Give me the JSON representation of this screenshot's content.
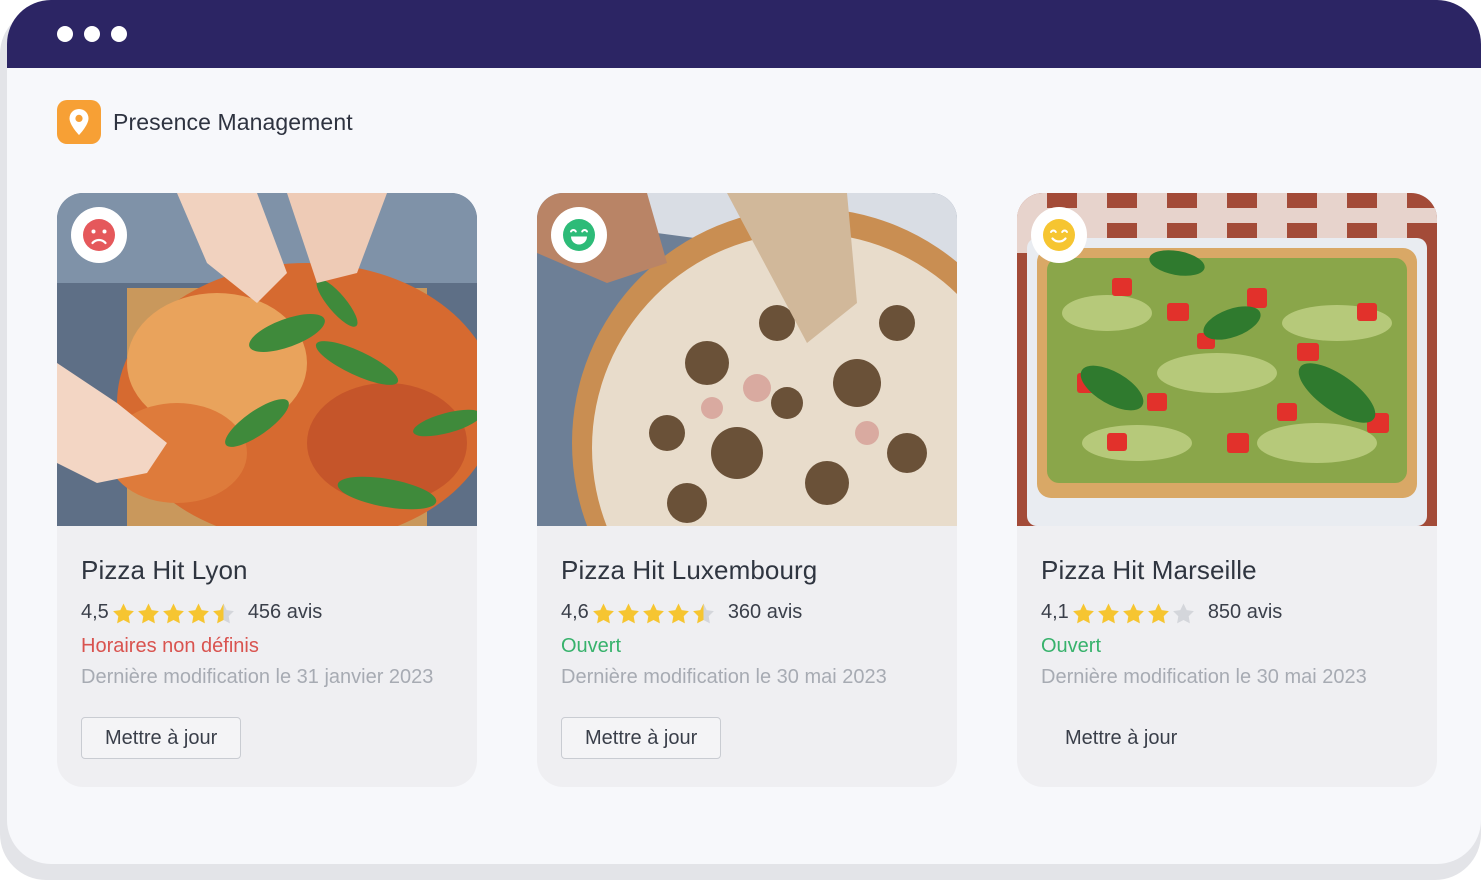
{
  "app": {
    "title": "Presence Management",
    "logo_icon": "map-pin-icon",
    "accent": "#f7a035",
    "titlebar_color": "#2c2564"
  },
  "window_controls": [
    "dot",
    "dot",
    "dot"
  ],
  "cards": [
    {
      "name": "Pizza Hit Lyon",
      "mood_icon": "sad-face-icon",
      "mood_color": "#e5585b",
      "rating": "4,5",
      "stars": 4.5,
      "reviews": "456 avis",
      "status": "Horaires non définis",
      "status_color": "#d9534f",
      "modified": "Dernière modification le 31 janvier 2023",
      "button": "Mettre à jour"
    },
    {
      "name": "Pizza Hit Luxembourg",
      "mood_icon": "grinning-face-icon",
      "mood_color": "#2dbb78",
      "rating": "4,6",
      "stars": 4.5,
      "reviews": "360 avis",
      "status": "Ouvert",
      "status_color": "#37b26c",
      "modified": "Dernière modification le 30 mai 2023",
      "button": "Mettre à jour"
    },
    {
      "name": "Pizza Hit Marseille",
      "mood_icon": "smiling-face-icon",
      "mood_color": "#f6c531",
      "rating": "4,1",
      "stars": 4,
      "reviews": "850 avis",
      "status": "Ouvert",
      "status_color": "#37b26c",
      "modified": "Dernière modification le 30 mai 2023",
      "button": "Mettre à jour"
    }
  ],
  "star_colors": {
    "filled": "#f6c531",
    "empty": "#d4d6db"
  }
}
